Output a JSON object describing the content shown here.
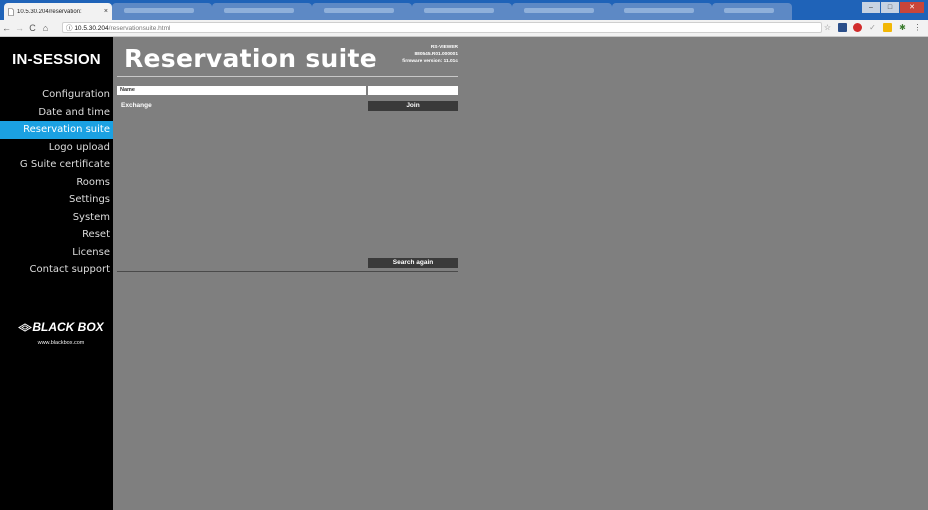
{
  "browser": {
    "tab_title": "10.5.30.204/reservation:",
    "tab_close": "×",
    "url_host": "10.5.30.204",
    "url_path": "/reservationsuite.html",
    "win_minimize": "–",
    "win_maximize": "□",
    "win_close": "✕"
  },
  "sidebar": {
    "brand": "IN-SESSION",
    "items": [
      {
        "label": "Configuration"
      },
      {
        "label": "Date and time"
      },
      {
        "label": "Reservation suite"
      },
      {
        "label": "Logo upload"
      },
      {
        "label": "G Suite certificate"
      },
      {
        "label": "Rooms"
      },
      {
        "label": "Settings"
      },
      {
        "label": "System"
      },
      {
        "label": "Reset"
      },
      {
        "label": "License"
      },
      {
        "label": "Contact support"
      }
    ],
    "active_index": 2,
    "logo_text": "BLACK BOX",
    "logo_url": "www.blackbox.com"
  },
  "main": {
    "title": "Reservation suite",
    "device_model": "RS-VIEWER",
    "device_serial": "880545.R01.000001",
    "firmware": "firmware version: 11.01c",
    "name_label": "Name",
    "name_value": "",
    "exchange_label": "Exchange",
    "join_label": "Join",
    "search_again_label": "Search again"
  },
  "colors": {
    "accent": "#1ba1e2",
    "background": "#7f7f7f",
    "sidebar": "#000000",
    "button": "#3a3a3a"
  }
}
